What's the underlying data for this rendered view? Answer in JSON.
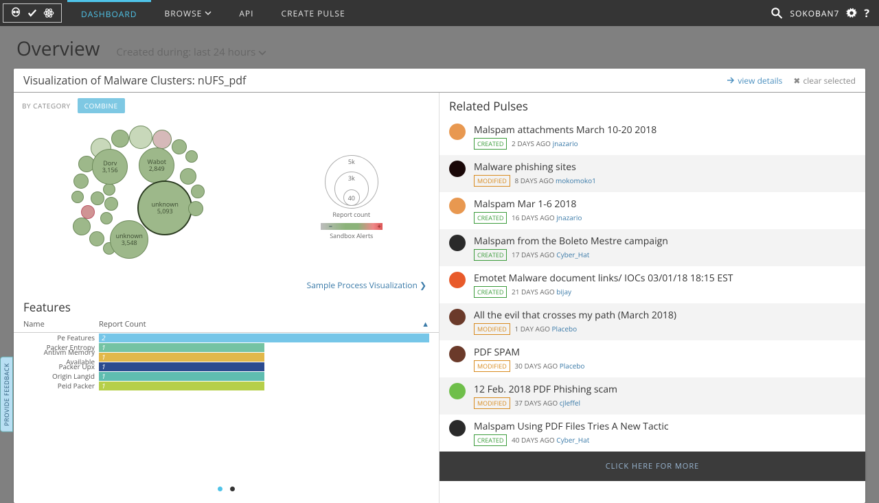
{
  "nav": {
    "dashboard": "DASHBOARD",
    "browse": "BROWSE",
    "api": "API",
    "create": "CREATE PULSE",
    "user": "SOKOBAN7"
  },
  "overview": {
    "title": "Overview",
    "filter": "Created during: last 24 hours"
  },
  "panel": {
    "title": "Visualization of Malware Clusters: nUFS_pdf",
    "view_details": "view details",
    "clear": "clear selected"
  },
  "cluster": {
    "by_category": "BY CATEGORY",
    "combine": "COMBINE",
    "report_count": "Report count",
    "sandbox_alerts": "Sandbox Alerts",
    "rings": {
      "r1": "5k",
      "r2": "3k",
      "r3": "40"
    },
    "bubbles": {
      "b1": {
        "name": "unknown",
        "count": "5,093"
      },
      "b2": {
        "name": "unknown",
        "count": "3,548"
      },
      "b3": {
        "name": "Wabot",
        "count": "2,849"
      },
      "b4": {
        "name": "Dorv",
        "count": "3,156"
      }
    },
    "sample_link": "Sample Process Visualization"
  },
  "features": {
    "heading": "Features",
    "col_name": "Name",
    "col_count": "Report Count",
    "rows": [
      {
        "name": "Pe Features",
        "count": "2",
        "color": "#76c6e8",
        "width": "100%"
      },
      {
        "name": "Packer Entropy",
        "count": "1",
        "color": "#74c3a3",
        "width": "50%"
      },
      {
        "name": "Antivm Memory Available",
        "count": "1",
        "color": "#e2b84a",
        "width": "50%"
      },
      {
        "name": "Packer Upx",
        "count": "1",
        "color": "#2c4b8f",
        "width": "50%"
      },
      {
        "name": "Origin Langid",
        "count": "1",
        "color": "#5fbdb0",
        "width": "50%"
      },
      {
        "name": "Peid Packer",
        "count": "1",
        "color": "#b6cf4a",
        "width": "50%"
      }
    ]
  },
  "related": {
    "heading": "Related Pulses",
    "more": "CLICK HERE FOR MORE",
    "pulses": [
      {
        "title": "Malspam attachments March 10-20 2018",
        "badge": "CREATED",
        "time": "2 DAYS AGO",
        "author": "jnazario",
        "avatar": "#e89850"
      },
      {
        "title": "Malware phishing sites",
        "badge": "MODIFIED",
        "time": "8 DAYS AGO",
        "author": "mokomoko1",
        "avatar": "#1a0808"
      },
      {
        "title": "Malspam Mar 1-6 2018",
        "badge": "CREATED",
        "time": "16 DAYS AGO",
        "author": "jnazario",
        "avatar": "#e89850"
      },
      {
        "title": "Malspam from the Boleto Mestre campaign",
        "badge": "CREATED",
        "time": "17 DAYS AGO",
        "author": "Cyber_Hat",
        "avatar": "#2a2a2a"
      },
      {
        "title": "Emotet Malware document links/ IOCs 03/01/18 18:15 EST",
        "badge": "CREATED",
        "time": "21 DAYS AGO",
        "author": "bijay",
        "avatar": "#e85a2a"
      },
      {
        "title": "All the evil that crosses my path (March 2018)",
        "badge": "MODIFIED",
        "time": "1 DAY AGO",
        "author": "Placebo",
        "avatar": "#6b3a2a"
      },
      {
        "title": "PDF SPAM",
        "badge": "MODIFIED",
        "time": "30 DAYS AGO",
        "author": "Placebo",
        "avatar": "#6b3a2a"
      },
      {
        "title": "12 Feb. 2018 PDF Phishing scam",
        "badge": "MODIFIED",
        "time": "37 DAYS AGO",
        "author": "cjleffel",
        "avatar": "#6fbf4a"
      },
      {
        "title": "Malspam Using PDF Files Tries A New Tactic",
        "badge": "CREATED",
        "time": "40 DAYS AGO",
        "author": "Cyber_Hat",
        "avatar": "#2a2a2a"
      }
    ]
  },
  "feedback": "PROVIDE FEEDBACK",
  "chart_data": {
    "type": "bar",
    "title": "Features – Report Count",
    "xlabel": "Report Count",
    "ylabel": "Name",
    "categories": [
      "Pe Features",
      "Packer Entropy",
      "Antivm Memory Available",
      "Packer Upx",
      "Origin Langid",
      "Peid Packer"
    ],
    "values": [
      2,
      1,
      1,
      1,
      1,
      1
    ]
  }
}
